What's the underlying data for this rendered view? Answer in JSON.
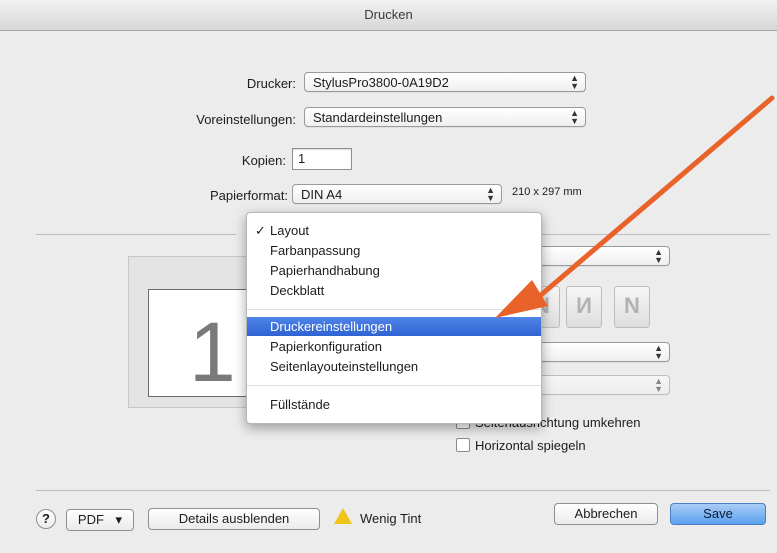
{
  "window": {
    "title": "Drucken"
  },
  "form": {
    "printer_label": "Drucker:",
    "printer_value": "StylusPro3800-0A19D2",
    "presets_label": "Voreinstellungen:",
    "presets_value": "Standardeinstellungen",
    "copies_label": "Kopien:",
    "copies_value": "1",
    "paper_label": "Papierformat:",
    "paper_value": "DIN A4",
    "paper_size": "210 x 297 mm"
  },
  "preview": {
    "page_number": "1"
  },
  "menu": {
    "items": [
      {
        "label": "Layout",
        "checked": true
      },
      {
        "label": "Farbanpassung"
      },
      {
        "label": "Papierhandhabung"
      },
      {
        "label": "Deckblatt"
      },
      {
        "label": "Druckereinstellungen",
        "selected": true
      },
      {
        "label": "Papierkonfiguration"
      },
      {
        "label": "Seitenlayouteinstellungen"
      },
      {
        "label": "Füllstände"
      }
    ],
    "check_mark": "✓"
  },
  "orientation_icons": [
    "N",
    "И",
    "N"
  ],
  "options": {
    "reverse_orientation": "Seitenausrichtung umkehren",
    "flip_horizontal": "Horizontal spiegeln"
  },
  "footer": {
    "help": "?",
    "pdf": "PDF",
    "pdf_arrow": "▾",
    "details": "Details ausblenden",
    "warning": "Wenig Tint",
    "cancel": "Abbrechen",
    "save": "Save"
  },
  "colors": {
    "accent": "#2f63d2",
    "arrow": "#e8622a",
    "warning": "#f0c419"
  }
}
